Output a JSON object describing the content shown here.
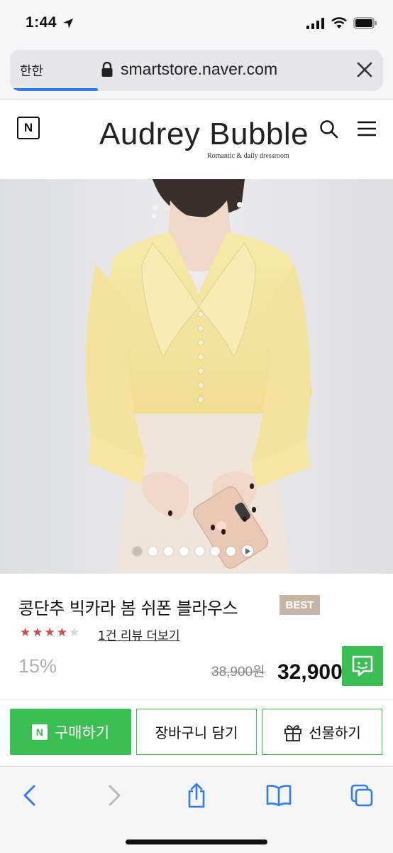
{
  "status_bar": {
    "time": "1:44"
  },
  "browser": {
    "aa_label": "한한",
    "url": "smartstore.naver.com"
  },
  "site": {
    "naver_logo": "N",
    "brand": "Audrey Bubble",
    "tagline": "Romantic & daily dressroom"
  },
  "gallery": {
    "total": 7,
    "active": 1
  },
  "product": {
    "title": "콩단추 빅카라 봄 쉬폰 블라우스",
    "badge": "BEST",
    "rating": 4,
    "rating_max": 5,
    "review_link": "1건 리뷰 더보기",
    "discount": "15%",
    "original_price": "38,900원",
    "sale_price": "32,900원"
  },
  "actions": {
    "buy_label": "구매하기",
    "buy_icon_text": "N",
    "cart_label": "장바구니 담기",
    "gift_label": "선물하기"
  },
  "colors": {
    "naver_green": "#3bbf52",
    "star_red": "#d84a4a",
    "badge_beige": "#c5b5a2",
    "ios_blue": "#2f7cf6"
  }
}
